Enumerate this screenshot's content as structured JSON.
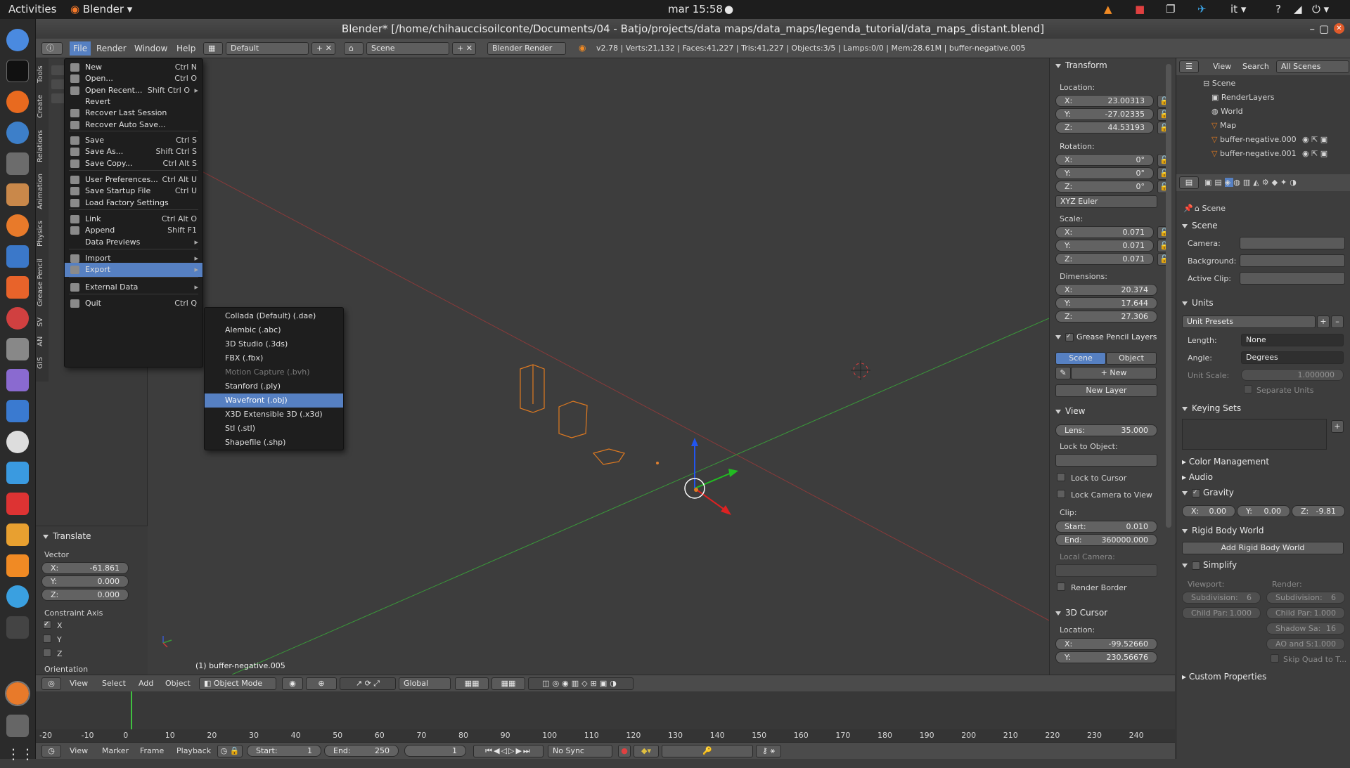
{
  "topbar": {
    "activities": "Activities",
    "app": "Blender",
    "clock": "mar 15:58",
    "lang": "it"
  },
  "window": {
    "title": "Blender* [/home/chihauccisoilconte/Documents/04 - Batjo/projects/data maps/data_maps/legenda_tutorial/data_maps_distant.blend]"
  },
  "info_header": {
    "menus": [
      "File",
      "Render",
      "Window",
      "Help"
    ],
    "screen_layout": "Default",
    "scene": "Scene",
    "engine": "Blender Render",
    "stats": "v2.78 | Verts:21,132 | Faces:41,227 | Tris:41,227 | Objects:3/5 | Lamps:0/0 | Mem:28.61M | buffer-negative.005"
  },
  "tool_tabs": [
    "Tools",
    "Create",
    "Relations",
    "Animation",
    "Physics",
    "Grease Pencil",
    "SV",
    "AN",
    "GIS"
  ],
  "file_menu": {
    "items": [
      {
        "label": "New",
        "shortcut": "Ctrl N"
      },
      {
        "label": "Open...",
        "shortcut": "Ctrl O"
      },
      {
        "label": "Open Recent...",
        "shortcut": "Shift Ctrl O"
      },
      {
        "label": "Revert",
        "shortcut": ""
      },
      {
        "label": "Recover Last Session",
        "shortcut": ""
      },
      {
        "label": "Recover Auto Save...",
        "shortcut": ""
      },
      {
        "label": "Save",
        "shortcut": "Ctrl S"
      },
      {
        "label": "Save As...",
        "shortcut": "Shift Ctrl S"
      },
      {
        "label": "Save Copy...",
        "shortcut": "Ctrl Alt S"
      },
      {
        "label": "User Preferences...",
        "shortcut": "Ctrl Alt U"
      },
      {
        "label": "Save Startup File",
        "shortcut": "Ctrl U"
      },
      {
        "label": "Load Factory Settings",
        "shortcut": ""
      },
      {
        "label": "Link",
        "shortcut": "Ctrl Alt O"
      },
      {
        "label": "Append",
        "shortcut": "Shift F1"
      },
      {
        "label": "Data Previews",
        "shortcut": ""
      },
      {
        "label": "Import",
        "shortcut": ""
      },
      {
        "label": "Export",
        "shortcut": ""
      },
      {
        "label": "External Data",
        "shortcut": ""
      },
      {
        "label": "Quit",
        "shortcut": "Ctrl Q"
      }
    ]
  },
  "export_menu": {
    "items": [
      "Collada (Default) (.dae)",
      "Alembic (.abc)",
      "3D Studio (.3ds)",
      "FBX (.fbx)",
      "Motion Capture (.bvh)",
      "Stanford (.ply)",
      "Wavefront (.obj)",
      "X3D Extensible 3D (.x3d)",
      "Stl (.stl)",
      "Shapefile (.shp)"
    ],
    "selected": "Wavefront (.obj)"
  },
  "translate_panel": {
    "title": "Translate",
    "vector_label": "Vector",
    "x": "-61.861",
    "y": "0.000",
    "z": "0.000",
    "constraint_label": "Constraint Axis",
    "axes": [
      "X",
      "Y",
      "Z"
    ],
    "orientation_label": "Orientation"
  },
  "viewport": {
    "object_label": "(1) buffer-negative.005"
  },
  "n_panel": {
    "transform": "Transform",
    "location": "Location:",
    "loc": {
      "x": "23.00313",
      "y": "-27.02335",
      "z": "44.53193"
    },
    "rotation": "Rotation:",
    "rot": {
      "x": "0°",
      "y": "0°",
      "z": "0°"
    },
    "rot_mode": "XYZ Euler",
    "scale": "Scale:",
    "scl": {
      "x": "0.071",
      "y": "0.071",
      "z": "0.071"
    },
    "dimensions": "Dimensions:",
    "dim": {
      "x": "20.374",
      "y": "17.644",
      "z": "27.306"
    },
    "gp_layers": "Grease Pencil Layers",
    "gp_scene": "Scene",
    "gp_object": "Object",
    "gp_new": "New",
    "gp_new_layer": "New Layer",
    "view": "View",
    "lens_label": "Lens:",
    "lens": "35.000",
    "lock_to_object": "Lock to Object:",
    "lock_cursor": "Lock to Cursor",
    "lock_camera": "Lock Camera to View",
    "clip": "Clip:",
    "clip_start_label": "Start:",
    "clip_start": "0.010",
    "clip_end_label": "End:",
    "clip_end": "360000.000",
    "local_camera": "Local Camera:",
    "render_border": "Render Border",
    "cursor3d": "3D Cursor",
    "cursor_location": "Location:",
    "cursor": {
      "x": "-99.52660",
      "y": "230.56676"
    }
  },
  "outliner": {
    "menus": [
      "View",
      "Search"
    ],
    "filter": "All Scenes",
    "items": [
      "Scene",
      "RenderLayers",
      "World",
      "Map",
      "buffer-negative.000",
      "buffer-negative.001"
    ]
  },
  "properties": {
    "context": "Scene",
    "scene_panel": "Scene",
    "camera": "Camera:",
    "background": "Background:",
    "active_clip": "Active Clip:",
    "units": "Units",
    "unit_presets": "Unit Presets",
    "length": "Length:",
    "length_val": "None",
    "angle": "Angle:",
    "angle_val": "Degrees",
    "unit_scale": "Unit Scale:",
    "unit_scale_val": "1.000000",
    "separate_units": "Separate Units",
    "keying_sets": "Keying Sets",
    "color_mgmt": "Color Management",
    "audio": "Audio",
    "gravity": "Gravity",
    "gx": "0.00",
    "gy": "0.00",
    "gz": "-9.81",
    "rigid_body": "Rigid Body World",
    "add_rigid": "Add Rigid Body World",
    "simplify": "Simplify",
    "viewport": "Viewport:",
    "render": "Render:",
    "subdivision": "Subdivision:",
    "subdiv_val": "6",
    "child_par": "Child Par:",
    "child_par_val": "1.000",
    "shadow_sa": "Shadow Sa:",
    "shadow_val": "16",
    "ao_sss": "AO and S:",
    "ao_val": "1.000",
    "skip_quad": "Skip Quad to T...",
    "custom_props": "Custom Properties"
  },
  "viewport_header": {
    "menus": [
      "View",
      "Select",
      "Add",
      "Object"
    ],
    "mode": "Object Mode",
    "orientation": "Global"
  },
  "timeline": {
    "ticks": [
      "-20",
      "-10",
      "0",
      "10",
      "20",
      "30",
      "40",
      "50",
      "60",
      "70",
      "80",
      "90",
      "100",
      "110",
      "120",
      "130",
      "140",
      "150",
      "160",
      "170",
      "180",
      "190",
      "200",
      "210",
      "220",
      "230",
      "240"
    ],
    "menus": [
      "View",
      "Marker",
      "Frame",
      "Playback"
    ],
    "start_label": "Start:",
    "start": "1",
    "end_label": "End:",
    "end": "250",
    "current": "1",
    "sync": "No Sync"
  }
}
